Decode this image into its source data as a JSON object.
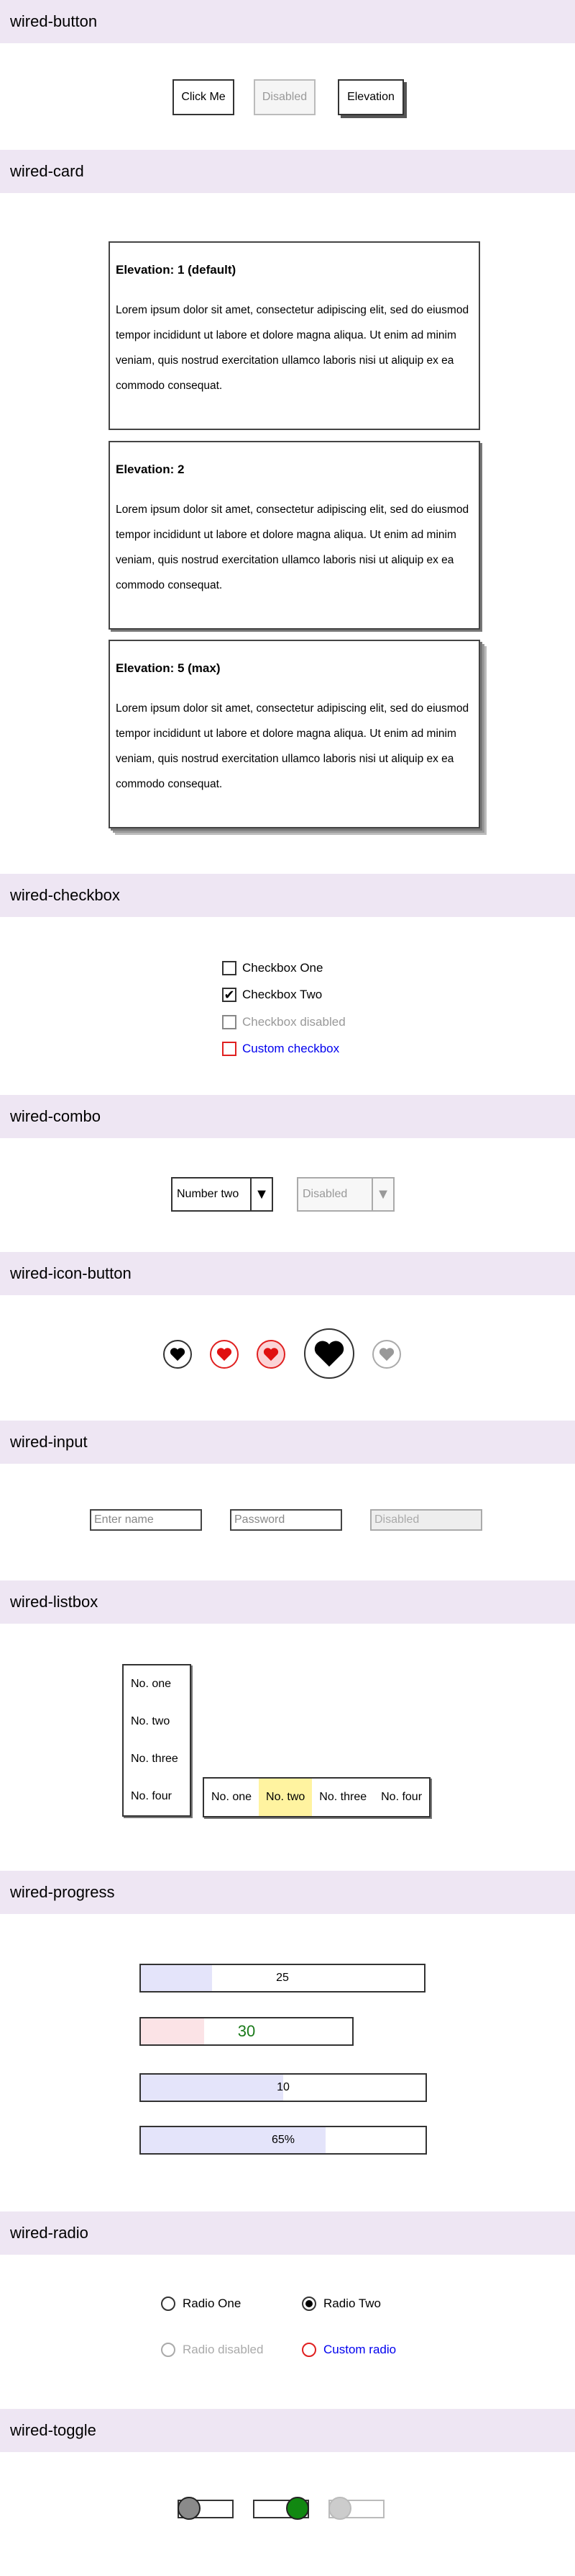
{
  "sections": {
    "button": "wired-button",
    "card": "wired-card",
    "checkbox": "wired-checkbox",
    "combo": "wired-combo",
    "icon_button": "wired-icon-button",
    "input": "wired-input",
    "listbox": "wired-listbox",
    "progress": "wired-progress",
    "radio": "wired-radio",
    "toggle": "wired-toggle"
  },
  "buttons": {
    "click": "Click Me",
    "disabled": "Disabled",
    "elevation": "Elevation"
  },
  "cards": [
    {
      "title": "Elevation: 1 (default)",
      "body": "Lorem ipsum dolor sit amet, consectetur adipiscing elit, sed do eiusmod tempor incididunt ut labore et dolore magna aliqua. Ut enim ad minim veniam, quis nostrud exercitation ullamco laboris nisi ut aliquip ex ea commodo consequat."
    },
    {
      "title": "Elevation: 2",
      "body": "Lorem ipsum dolor sit amet, consectetur adipiscing elit, sed do eiusmod tempor incididunt ut labore et dolore magna aliqua. Ut enim ad minim veniam, quis nostrud exercitation ullamco laboris nisi ut aliquip ex ea commodo consequat."
    },
    {
      "title": "Elevation: 5 (max)",
      "body": "Lorem ipsum dolor sit amet, consectetur adipiscing elit, sed do eiusmod tempor incididunt ut labore et dolore magna aliqua. Ut enim ad minim veniam, quis nostrud exercitation ullamco laboris nisi ut aliquip ex ea commodo consequat."
    }
  ],
  "checkboxes": [
    {
      "label": "Checkbox One",
      "checked": false
    },
    {
      "label": "Checkbox Two",
      "checked": true
    },
    {
      "label": "Checkbox disabled",
      "checked": false
    },
    {
      "label": "Custom checkbox",
      "checked": false
    }
  ],
  "combos": {
    "selected": "Number two",
    "disabled": "Disabled"
  },
  "icon_buttons": [
    "heart-icon",
    "heart-icon",
    "heart-icon",
    "heart-icon",
    "heart-icon"
  ],
  "inputs": {
    "name_placeholder": "Enter name",
    "password_placeholder": "Password",
    "disabled_placeholder": "Disabled"
  },
  "listbox": {
    "vertical": [
      "No. one",
      "No. two",
      "No. three",
      "No. four"
    ],
    "horizontal": [
      "No. one",
      "No. two",
      "No. three",
      "No. four"
    ],
    "horizontal_selected": "No. two"
  },
  "progress": [
    {
      "label": "25",
      "percent": 25
    },
    {
      "label": "30",
      "percent": 30
    },
    {
      "label": "10",
      "percent": 50
    },
    {
      "label": "65%",
      "percent": 65
    }
  ],
  "radios": [
    {
      "label": "Radio One",
      "checked": false
    },
    {
      "label": "Radio Two",
      "checked": true
    },
    {
      "label": "Radio disabled",
      "checked": false
    },
    {
      "label": "Custom radio",
      "checked": false
    }
  ],
  "toggles": [
    {
      "state": "off"
    },
    {
      "state": "on"
    },
    {
      "state": "disabled"
    }
  ],
  "colors": {
    "header_bg": "#eee6f3",
    "custom": "#0000ee",
    "custom_border": "#e02020",
    "selected": "#fff3a0",
    "progress_fill": "#e4e4fa",
    "progress_fill_red": "#fbe3e6",
    "progress_text_green": "#1a7a1a",
    "toggle_on": "#118811"
  }
}
